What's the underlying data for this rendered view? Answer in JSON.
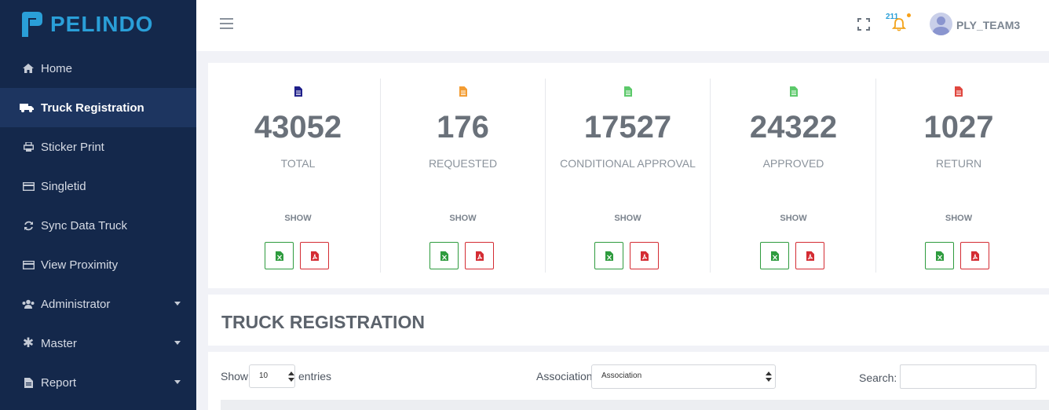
{
  "brand": {
    "name": "PELINDO",
    "logo_color": "#2a9fd8"
  },
  "sidebar": {
    "items": [
      {
        "label": "Home",
        "icon": "home-icon",
        "active": false,
        "has_submenu": false
      },
      {
        "label": "Truck Registration",
        "icon": "truck-icon",
        "active": true,
        "has_submenu": false
      },
      {
        "label": "Sticker Print",
        "icon": "printer-icon",
        "active": false,
        "has_submenu": false
      },
      {
        "label": "Singletid",
        "icon": "card-icon",
        "active": false,
        "has_submenu": false
      },
      {
        "label": "Sync Data Truck",
        "icon": "sync-icon",
        "active": false,
        "has_submenu": false
      },
      {
        "label": "View Proximity",
        "icon": "card-icon",
        "active": false,
        "has_submenu": false
      },
      {
        "label": "Administrator",
        "icon": "users-icon",
        "active": false,
        "has_submenu": true
      },
      {
        "label": "Master",
        "icon": "asterisk-icon",
        "active": false,
        "has_submenu": true
      },
      {
        "label": "Report",
        "icon": "file-icon",
        "active": false,
        "has_submenu": true
      }
    ]
  },
  "header": {
    "notification_count": "211",
    "username": "PLY_TEAM3"
  },
  "stats": [
    {
      "value": "43052",
      "label": "TOTAL",
      "show": "SHOW",
      "icon_color": "#1f1f8a"
    },
    {
      "value": "176",
      "label": "REQUESTED",
      "show": "SHOW",
      "icon_color": "#f39c32"
    },
    {
      "value": "17527",
      "label": "CONDITIONAL APPROVAL",
      "show": "SHOW",
      "icon_color": "#5cc96a"
    },
    {
      "value": "24322",
      "label": "APPROVED",
      "show": "SHOW",
      "icon_color": "#5cc96a"
    },
    {
      "value": "1027",
      "label": "RETURN",
      "show": "SHOW",
      "icon_color": "#e0473f"
    }
  ],
  "page_title": "TRUCK REGISTRATION",
  "table_controls": {
    "show_label": "Show",
    "entries_value": "10",
    "entries_label": "entries",
    "association_label": "Association:",
    "association_value": "Association",
    "search_label": "Search:"
  },
  "colors": {
    "sidebar_bg": "#14284b",
    "excel": "#2e9b3e",
    "pdf": "#d42c33"
  }
}
